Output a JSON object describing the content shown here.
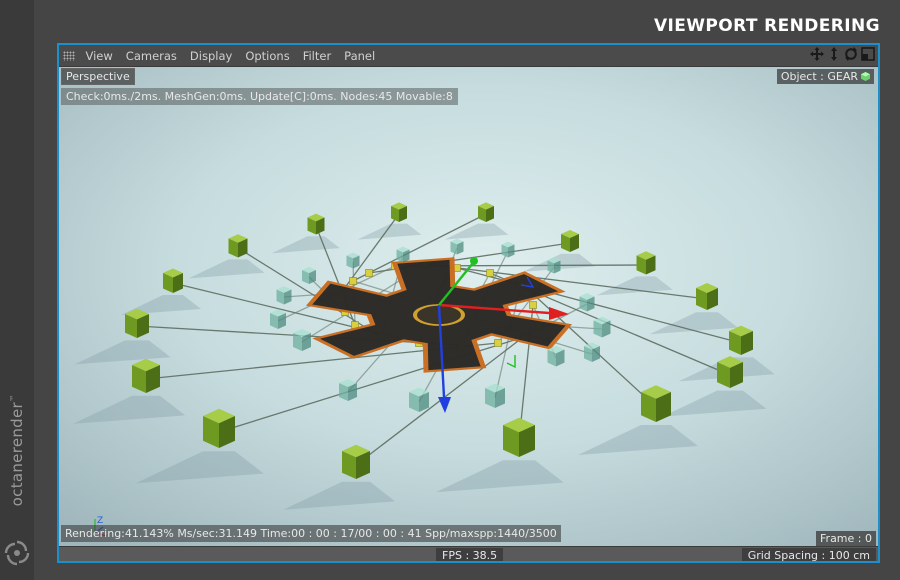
{
  "page": {
    "title": "VIEWPORT RENDERING"
  },
  "brand": {
    "name": "octanerender",
    "trademark": "™"
  },
  "menu": {
    "items": [
      {
        "label": "View"
      },
      {
        "label": "Cameras"
      },
      {
        "label": "Display"
      },
      {
        "label": "Options"
      },
      {
        "label": "Filter"
      },
      {
        "label": "Panel"
      }
    ],
    "nav_icons": [
      "move-icon",
      "zoom-icon",
      "rotate-icon",
      "maximize-icon"
    ]
  },
  "viewport": {
    "camera_label": "Perspective",
    "object_label": "Object : GEAR",
    "stats": "Check:0ms./2ms. MeshGen:0ms. Update[C]:0ms. Nodes:45 Movable:8",
    "render_status": "Rendering:41.143% Ms/sec:31.149 Time:00 : 00 : 17/00 : 00 : 41 Spp/maxspp:1440/3500",
    "frame": "Frame : 0"
  },
  "statusbar": {
    "fps": "FPS : 38.5",
    "grid_spacing": "Grid Spacing : 100 cm"
  },
  "colors": {
    "viewport_border": "#1d90cc",
    "axis_x": "#e02020",
    "axis_y": "#20c020",
    "axis_z": "#2040e0",
    "cube_green": "#6f9a22",
    "cube_glass": "#6fb0a0",
    "node_yellow": "#d8d040"
  }
}
